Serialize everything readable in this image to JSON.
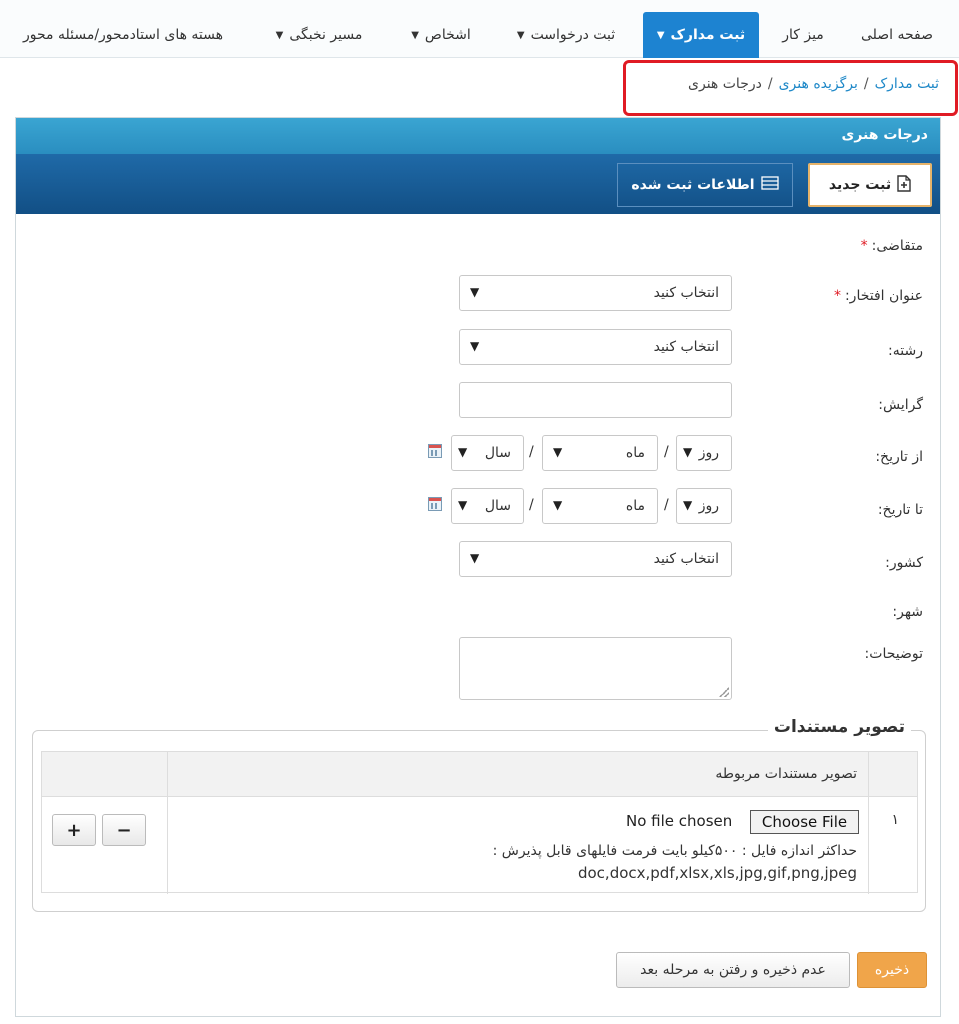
{
  "nav": {
    "items": [
      {
        "label": "صفحه اصلی",
        "dropdown": false,
        "active": false
      },
      {
        "label": "میز کار",
        "dropdown": false,
        "active": false
      },
      {
        "label": "ثبت مدارک",
        "dropdown": true,
        "active": true
      },
      {
        "label": "ثبت درخواست",
        "dropdown": true,
        "active": false
      },
      {
        "label": "اشخاص",
        "dropdown": true,
        "active": false
      },
      {
        "label": "مسیر نخبگی",
        "dropdown": true,
        "active": false
      },
      {
        "label": "هسته های استادمحور/مسئله محور",
        "dropdown": false,
        "active": false
      }
    ]
  },
  "breadcrumb": {
    "level1": "ثبت مدارک",
    "level2": "برگزیده هنری",
    "current": "درجات هنری",
    "separator": "/"
  },
  "panel": {
    "title": "درجات هنری",
    "new_button": "ثبت جدید",
    "list_button": "اطلاعات ثبت شده"
  },
  "form": {
    "applicant_label": "متقاضی:",
    "honor_label": "عنوان افتخار:",
    "honor_value": "انتخاب کنید",
    "field_label": "رشته:",
    "field_value": "انتخاب کنید",
    "branch_label": "گرایش:",
    "branch_value": "",
    "from_label": "از تاریخ:",
    "from_day": "روز",
    "from_month": "ماه",
    "from_year": "سال",
    "to_label": "تا تاریخ:",
    "to_day": "روز",
    "to_month": "ماه",
    "to_year": "سال",
    "country_label": "کشور:",
    "country_value": "انتخاب کنید",
    "city_label": "شهر:",
    "notes_label": "توضیحات:",
    "required_mark": "*",
    "date_separator": "/"
  },
  "documents": {
    "legend": "تصویر مستندات",
    "column_header": "تصویر مستندات مربوطه",
    "row_number": "۱",
    "choose_file": "Choose File",
    "no_file": "No file chosen",
    "help_text": "حداکثر اندازه فایل : ۵۰۰کیلو بایت فرمت فایلهای قابل پذیرش :",
    "file_types": "doc,docx,pdf,xlsx,xls,jpg,gif,png,jpeg",
    "add_symbol": "+",
    "remove_symbol": "−"
  },
  "actions": {
    "save": "ذخیره",
    "skip": "عدم ذخیره و رفتن به مرحله بعد"
  },
  "colors": {
    "nav_active": "#1d83d1",
    "panel_header": "#2a8ec0",
    "toolbar": "#124f85",
    "link": "#1e88c8",
    "highlight": "#e01b24",
    "save_button": "#f0a54a"
  }
}
